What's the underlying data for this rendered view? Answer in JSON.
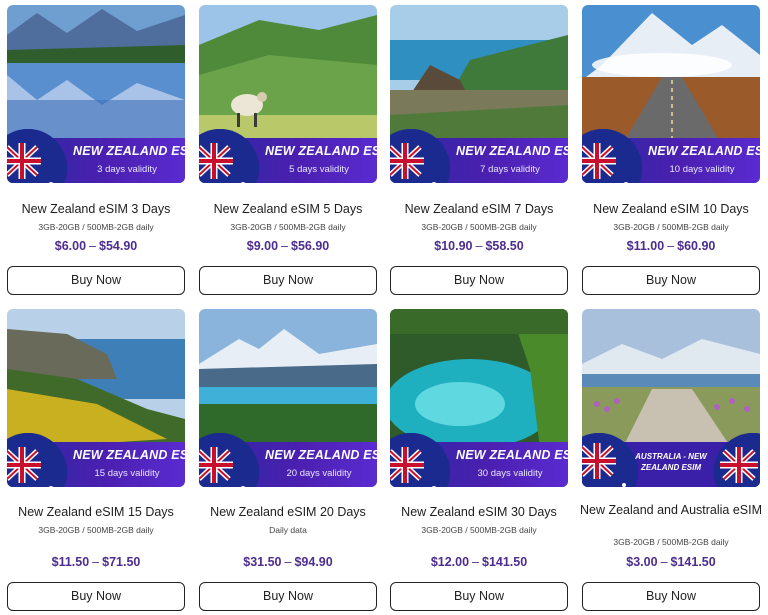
{
  "products": [
    {
      "id": "nz3",
      "banner_title": "NEW ZEALAND ESIM",
      "banner_sub": "3 days validity",
      "title": "New Zealand eSIM 3 Days",
      "spec": "3GB-20GB / 500MB-2GB daily",
      "price_min": "$6.00",
      "price_sep": "–",
      "price_max": "$54.90",
      "button": "Buy Now",
      "scene": "lake-mountains"
    },
    {
      "id": "nz5",
      "banner_title": "NEW ZEALAND ESIM",
      "banner_sub": "5 days validity",
      "title": "New Zealand eSIM 5 Days",
      "spec": "3GB-20GB / 500MB-2GB daily",
      "price_min": "$9.00",
      "price_sep": "–",
      "price_max": "$56.90",
      "button": "Buy Now",
      "scene": "sheep-hills"
    },
    {
      "id": "nz7",
      "banner_title": "NEW ZEALAND ESIM",
      "banner_sub": "7 days validity",
      "title": "New Zealand eSIM 7 Days",
      "spec": "3GB-20GB / 500MB-2GB daily",
      "price_min": "$10.90",
      "price_sep": "–",
      "price_max": "$58.50",
      "button": "Buy Now",
      "scene": "coast-rock"
    },
    {
      "id": "nz10",
      "banner_title": "NEW ZEALAND ESIM",
      "banner_sub": "10 days validity",
      "title": "New Zealand eSIM 10 Days",
      "spec": "3GB-20GB / 500MB-2GB daily",
      "price_min": "$11.00",
      "price_sep": "–",
      "price_max": "$60.90",
      "button": "Buy Now",
      "scene": "road-mountain"
    },
    {
      "id": "nz15",
      "banner_title": "NEW ZEALAND ESIM",
      "banner_sub": "15 days validity",
      "title": "New Zealand eSIM 15 Days",
      "spec": "3GB-20GB / 500MB-2GB daily",
      "price_min": "$11.50",
      "price_sep": "–",
      "price_max": "$71.50",
      "button": "Buy Now",
      "scene": "cliff-flowers"
    },
    {
      "id": "nz20",
      "banner_title": "NEW ZEALAND ESIM",
      "banner_sub": "20 days validity",
      "title": "New Zealand eSIM 20 Days",
      "spec": "Daily data",
      "price_min": "$31.50",
      "price_sep": "–",
      "price_max": "$94.90",
      "button": "Buy Now",
      "scene": "alpine-lake"
    },
    {
      "id": "nz30",
      "banner_title": "NEW ZEALAND ESIM",
      "banner_sub": "30 days validity",
      "title": "New Zealand eSIM 30 Days",
      "spec": "3GB-20GB / 500MB-2GB daily",
      "price_min": "$12.00",
      "price_sep": "–",
      "price_max": "$141.50",
      "button": "Buy Now",
      "scene": "blue-spring"
    },
    {
      "id": "nzau",
      "banner_title": "AUSTRALIA - NEW ZEALAND ESIM",
      "banner_sub": "",
      "title": "New Zealand and Australia eSIM",
      "spec": "3GB-20GB / 500MB-2GB daily",
      "price_min": "$3.00",
      "price_sep": "–",
      "price_max": "$141.50",
      "button": "Buy Now",
      "scene": "lupins"
    }
  ],
  "colors": {
    "price": "#4d2d8f",
    "banner": "#4b1fb0",
    "flag_blue": "#1b2a8f",
    "flag_red": "#c8102e"
  }
}
